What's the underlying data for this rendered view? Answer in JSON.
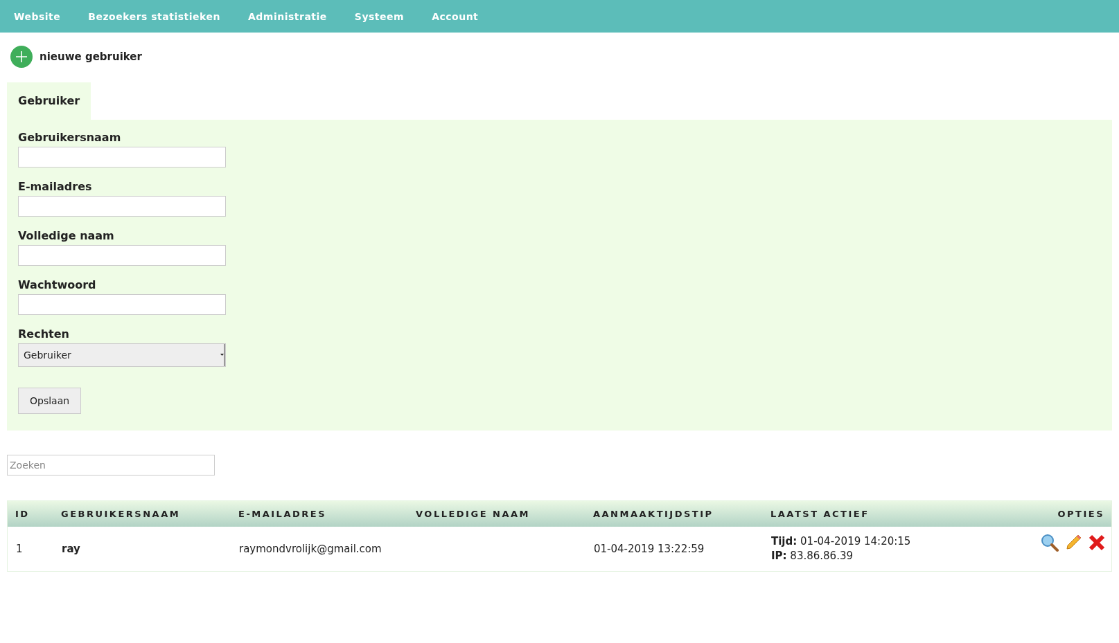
{
  "nav": [
    "Website",
    "Bezoekers statistieken",
    "Administratie",
    "Systeem",
    "Account"
  ],
  "new_user": {
    "label": "nieuwe gebruiker"
  },
  "tabs": [
    {
      "label": "Gebruiker",
      "selected": true
    }
  ],
  "form": {
    "fields": [
      {
        "kind": "text",
        "label": "Gebruikersnaam"
      },
      {
        "kind": "text",
        "label": "E-mailadres"
      },
      {
        "kind": "text",
        "label": "Volledige naam"
      },
      {
        "kind": "password",
        "label": "Wachtwoord"
      },
      {
        "kind": "select",
        "label": "Rechten",
        "value": "Gebruiker"
      }
    ],
    "submit": "Opslaan"
  },
  "search": {
    "placeholder": "Zoeken"
  },
  "table": {
    "columns": [
      "ID",
      "GEBRUIKERSNAAM",
      "E-MAILADRES",
      "VOLLEDIGE NAAM",
      "AANMAAKTIJDSTIP",
      "LAATST ACTIEF",
      "OPTIES"
    ],
    "rows": [
      {
        "id": "1",
        "username": "ray",
        "email": "raymondvrolijk@gmail.com",
        "created": "01-04-2019 13:22:59",
        "last_active": {
          "time_label": "Tijd:",
          "time": "01-04-2019 14:20:15",
          "ip_label": "IP:",
          "ip": "83.86.86.39"
        }
      }
    ]
  }
}
